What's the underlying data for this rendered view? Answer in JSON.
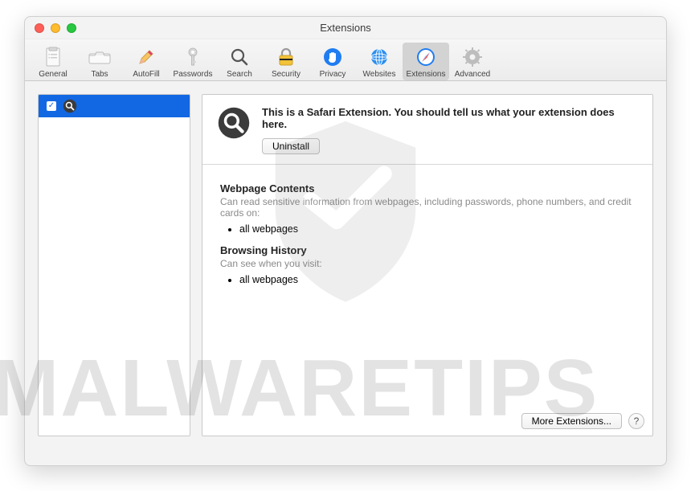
{
  "window": {
    "title": "Extensions"
  },
  "toolbar": [
    {
      "id": "general",
      "label": "General"
    },
    {
      "id": "tabs",
      "label": "Tabs"
    },
    {
      "id": "autofill",
      "label": "AutoFill"
    },
    {
      "id": "passwords",
      "label": "Passwords"
    },
    {
      "id": "search",
      "label": "Search"
    },
    {
      "id": "security",
      "label": "Security"
    },
    {
      "id": "privacy",
      "label": "Privacy"
    },
    {
      "id": "websites",
      "label": "Websites"
    },
    {
      "id": "extensions",
      "label": "Extensions",
      "selected": true
    },
    {
      "id": "advanced",
      "label": "Advanced"
    }
  ],
  "sidebar": {
    "items": [
      {
        "checked": true,
        "icon": "search-icon"
      }
    ]
  },
  "detail": {
    "description": "This is a Safari Extension. You should tell us what your extension does here.",
    "uninstall_label": "Uninstall",
    "sections": [
      {
        "heading": "Webpage Contents",
        "text": "Can read sensitive information from webpages, including passwords, phone numbers, and credit cards on:",
        "items": [
          "all webpages"
        ]
      },
      {
        "heading": "Browsing History",
        "text": "Can see when you visit:",
        "items": [
          "all webpages"
        ]
      }
    ]
  },
  "footer": {
    "more_label": "More Extensions...",
    "help_label": "?"
  },
  "watermark": "MALWARETIPS"
}
